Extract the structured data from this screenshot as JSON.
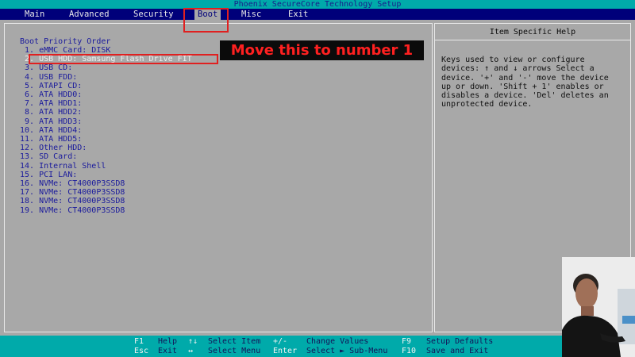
{
  "title": "Phoenix SecureCore Technology Setup",
  "menu": [
    {
      "label": "Main",
      "active": false
    },
    {
      "label": "Advanced",
      "active": false
    },
    {
      "label": "Security",
      "active": false
    },
    {
      "label": "Boot",
      "active": true
    },
    {
      "label": "Misc",
      "active": false
    },
    {
      "label": "Exit",
      "active": false
    }
  ],
  "boot": {
    "section_title": "Boot Priority Order",
    "items": [
      " 1. eMMC Card: DISK",
      " 2. USB HDD: Samsung Flash Drive FIT",
      " 3. USB CD:",
      " 4. USB FDD:",
      " 5. ATAPI CD:",
      " 6. ATA HDD0:",
      " 7. ATA HDD1:",
      " 8. ATA HDD2:",
      " 9. ATA HDD3:",
      "10. ATA HDD4:",
      "11. ATA HDD5:",
      "12. Other HDD:",
      "13. SD Card:",
      "14. Internal Shell",
      "15. PCI LAN:",
      "16. NVMe: CT4000P3SSD8",
      "17. NVMe: CT4000P3SSD8",
      "18. NVMe: CT4000P3SSD8",
      "19. NVMe: CT4000P3SSD8"
    ]
  },
  "help": {
    "title": "Item Specific Help",
    "text": "Keys used to view or configure\ndevices: ↑ and ↓ arrows Select a\ndevice. '+' and '-' move the device\nup or down. 'Shift + 1' enables or\ndisables a device. 'Del' deletes an\nunprotected device."
  },
  "annotation": {
    "label": "Move this to number 1"
  },
  "footer": {
    "row1": [
      {
        "key": "F1",
        "desc": "Help"
      },
      {
        "key": "↑↓",
        "desc": "Select Item"
      },
      {
        "key": "+/-",
        "desc": "Change Values"
      },
      {
        "key": "F9",
        "desc": "Setup Defaults"
      }
    ],
    "row2": [
      {
        "key": "Esc",
        "desc": "Exit"
      },
      {
        "key": "↔",
        "desc": "Select Menu"
      },
      {
        "key": "Enter",
        "desc": "Select ► Sub-Menu"
      },
      {
        "key": "F10",
        "desc": "Save and Exit"
      }
    ]
  }
}
